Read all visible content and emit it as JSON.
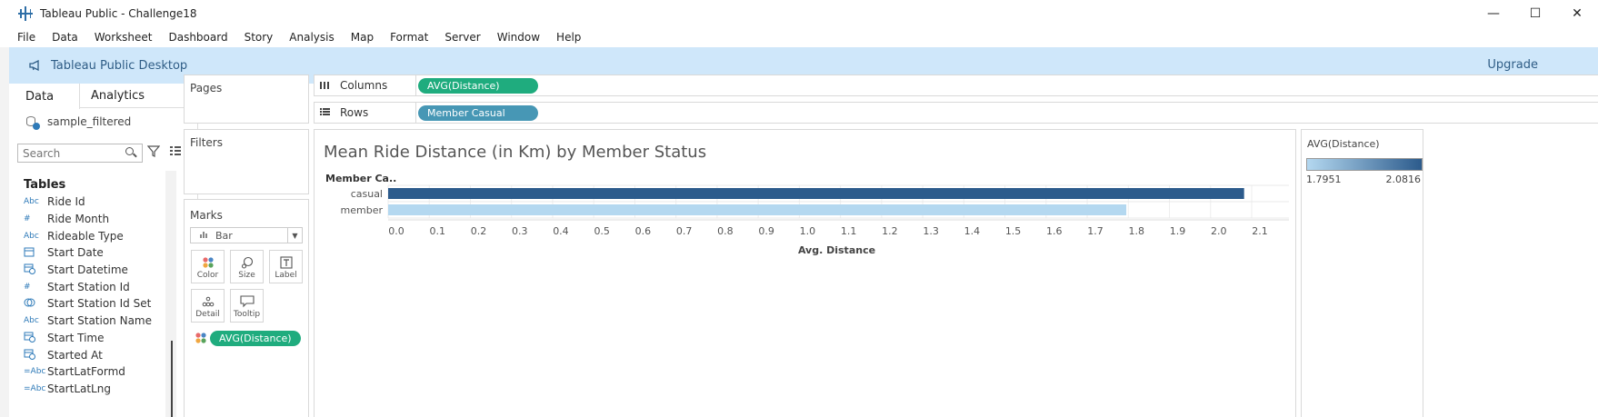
{
  "window": {
    "title": "Tableau Public - Challenge18",
    "minimize_glyph": "—",
    "maximize_glyph": "☐",
    "close_glyph": "✕"
  },
  "menu": [
    "File",
    "Data",
    "Worksheet",
    "Dashboard",
    "Story",
    "Analysis",
    "Map",
    "Format",
    "Server",
    "Window",
    "Help"
  ],
  "banner": {
    "text": "Tableau Public Desktop",
    "upgrade_label": "Upgrade",
    "color": "#cfe7fa"
  },
  "data_pane": {
    "tabs": [
      "Data",
      "Analytics"
    ],
    "datasource": "sample_filtered",
    "search_placeholder": "Search",
    "tables_heading": "Tables",
    "fields": [
      {
        "icon": "Abc",
        "name": "Ride Id"
      },
      {
        "icon": "#",
        "name": "Ride Month"
      },
      {
        "icon": "Abc",
        "name": "Rideable Type"
      },
      {
        "icon": "date-icon",
        "name": "Start Date"
      },
      {
        "icon": "datetime-icon",
        "name": "Start Datetime"
      },
      {
        "icon": "#",
        "name": "Start Station Id"
      },
      {
        "icon": "set-icon",
        "name": "Start Station Id Set"
      },
      {
        "icon": "Abc",
        "name": "Start Station Name"
      },
      {
        "icon": "datetime-icon",
        "name": "Start Time"
      },
      {
        "icon": "datetime-icon",
        "name": "Started At"
      },
      {
        "icon": "=Abc",
        "name": "StartLatFormd"
      },
      {
        "icon": "=Abc",
        "name": "StartLatLng"
      }
    ]
  },
  "cards": {
    "pages": "Pages",
    "filters": "Filters",
    "marks": "Marks",
    "mark_type": "Bar",
    "mark_buttons": [
      "Color",
      "Size",
      "Label",
      "Detail",
      "Tooltip"
    ],
    "marks_pill": "AVG(Distance)"
  },
  "shelves": {
    "columns_label": "Columns",
    "columns_pill": "AVG(Distance)",
    "rows_label": "Rows",
    "rows_pill": "Member Casual"
  },
  "legend": {
    "title": "AVG(Distance)",
    "min": "1.7951",
    "max": "2.0816",
    "color_low": "#b4d8f0",
    "color_high": "#2c5b8c"
  },
  "chart_data": {
    "type": "bar",
    "orientation": "horizontal",
    "title": "Mean Ride Distance (in Km) by Member Status",
    "row_header": "Member Ca..",
    "categories": [
      "casual",
      "member"
    ],
    "values": [
      2.0816,
      1.7951
    ],
    "colors": [
      "#2c5b8c",
      "#b4d8f0"
    ],
    "xlabel": "Avg. Distance",
    "xlim": [
      0,
      2.1
    ],
    "xticks": [
      "0.0",
      "0.1",
      "0.2",
      "0.3",
      "0.4",
      "0.5",
      "0.6",
      "0.7",
      "0.8",
      "0.9",
      "1.0",
      "1.1",
      "1.2",
      "1.3",
      "1.4",
      "1.5",
      "1.6",
      "1.7",
      "1.8",
      "1.9",
      "2.0",
      "2.1"
    ],
    "grid": true
  }
}
